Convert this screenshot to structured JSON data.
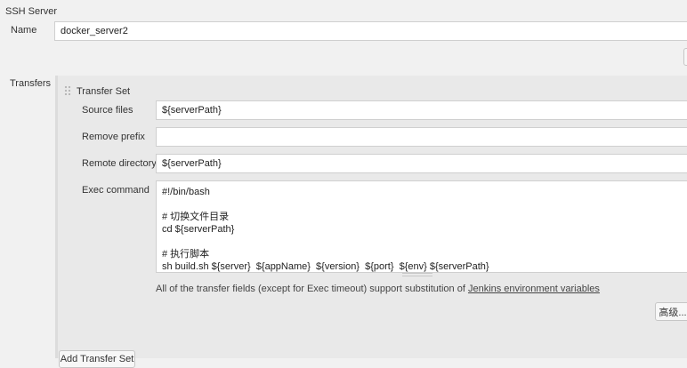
{
  "section_title": "SSH Server",
  "name": {
    "label": "Name",
    "value": "docker_server2"
  },
  "transfers_label": "Transfers",
  "transfer_set": {
    "title": "Transfer Set",
    "source_files": {
      "label": "Source files",
      "value": "${serverPath}"
    },
    "remove_prefix": {
      "label": "Remove prefix",
      "value": ""
    },
    "remote_directory": {
      "label": "Remote directory",
      "value": "${serverPath}"
    },
    "exec_command": {
      "label": "Exec command",
      "lines": [
        "#!/bin/bash",
        "",
        "# 切换文件目录",
        "cd ${serverPath}",
        "",
        "# 执行脚本",
        "sh build.sh ${server}  ${appName}  ${version}  ${port}  ${env} ${serverPath}"
      ]
    },
    "help_text": "All of the transfer fields (except for Exec timeout) support substitution of ",
    "help_link": "Jenkins environment variables",
    "advanced_button": "高级..."
  },
  "add_transfer_set_button": "Add Transfer Set"
}
